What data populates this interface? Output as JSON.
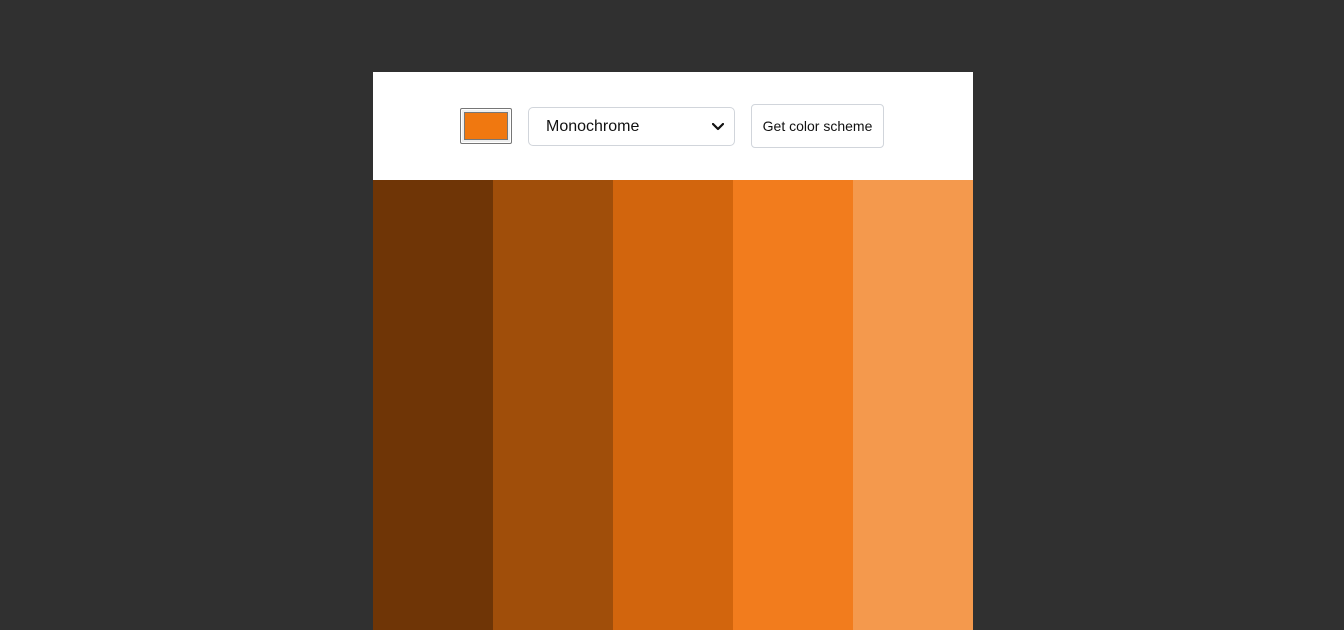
{
  "picker": {
    "value": "#f07810"
  },
  "mode_select": {
    "selected": "Monochrome"
  },
  "scheme_button": {
    "label": "Get color scheme"
  },
  "palette": {
    "colors": [
      "#6f3506",
      "#a04e0a",
      "#d2650d",
      "#f27c1d",
      "#f4994d"
    ]
  },
  "icons": {
    "select_arrow": "chevron-down-icon"
  }
}
